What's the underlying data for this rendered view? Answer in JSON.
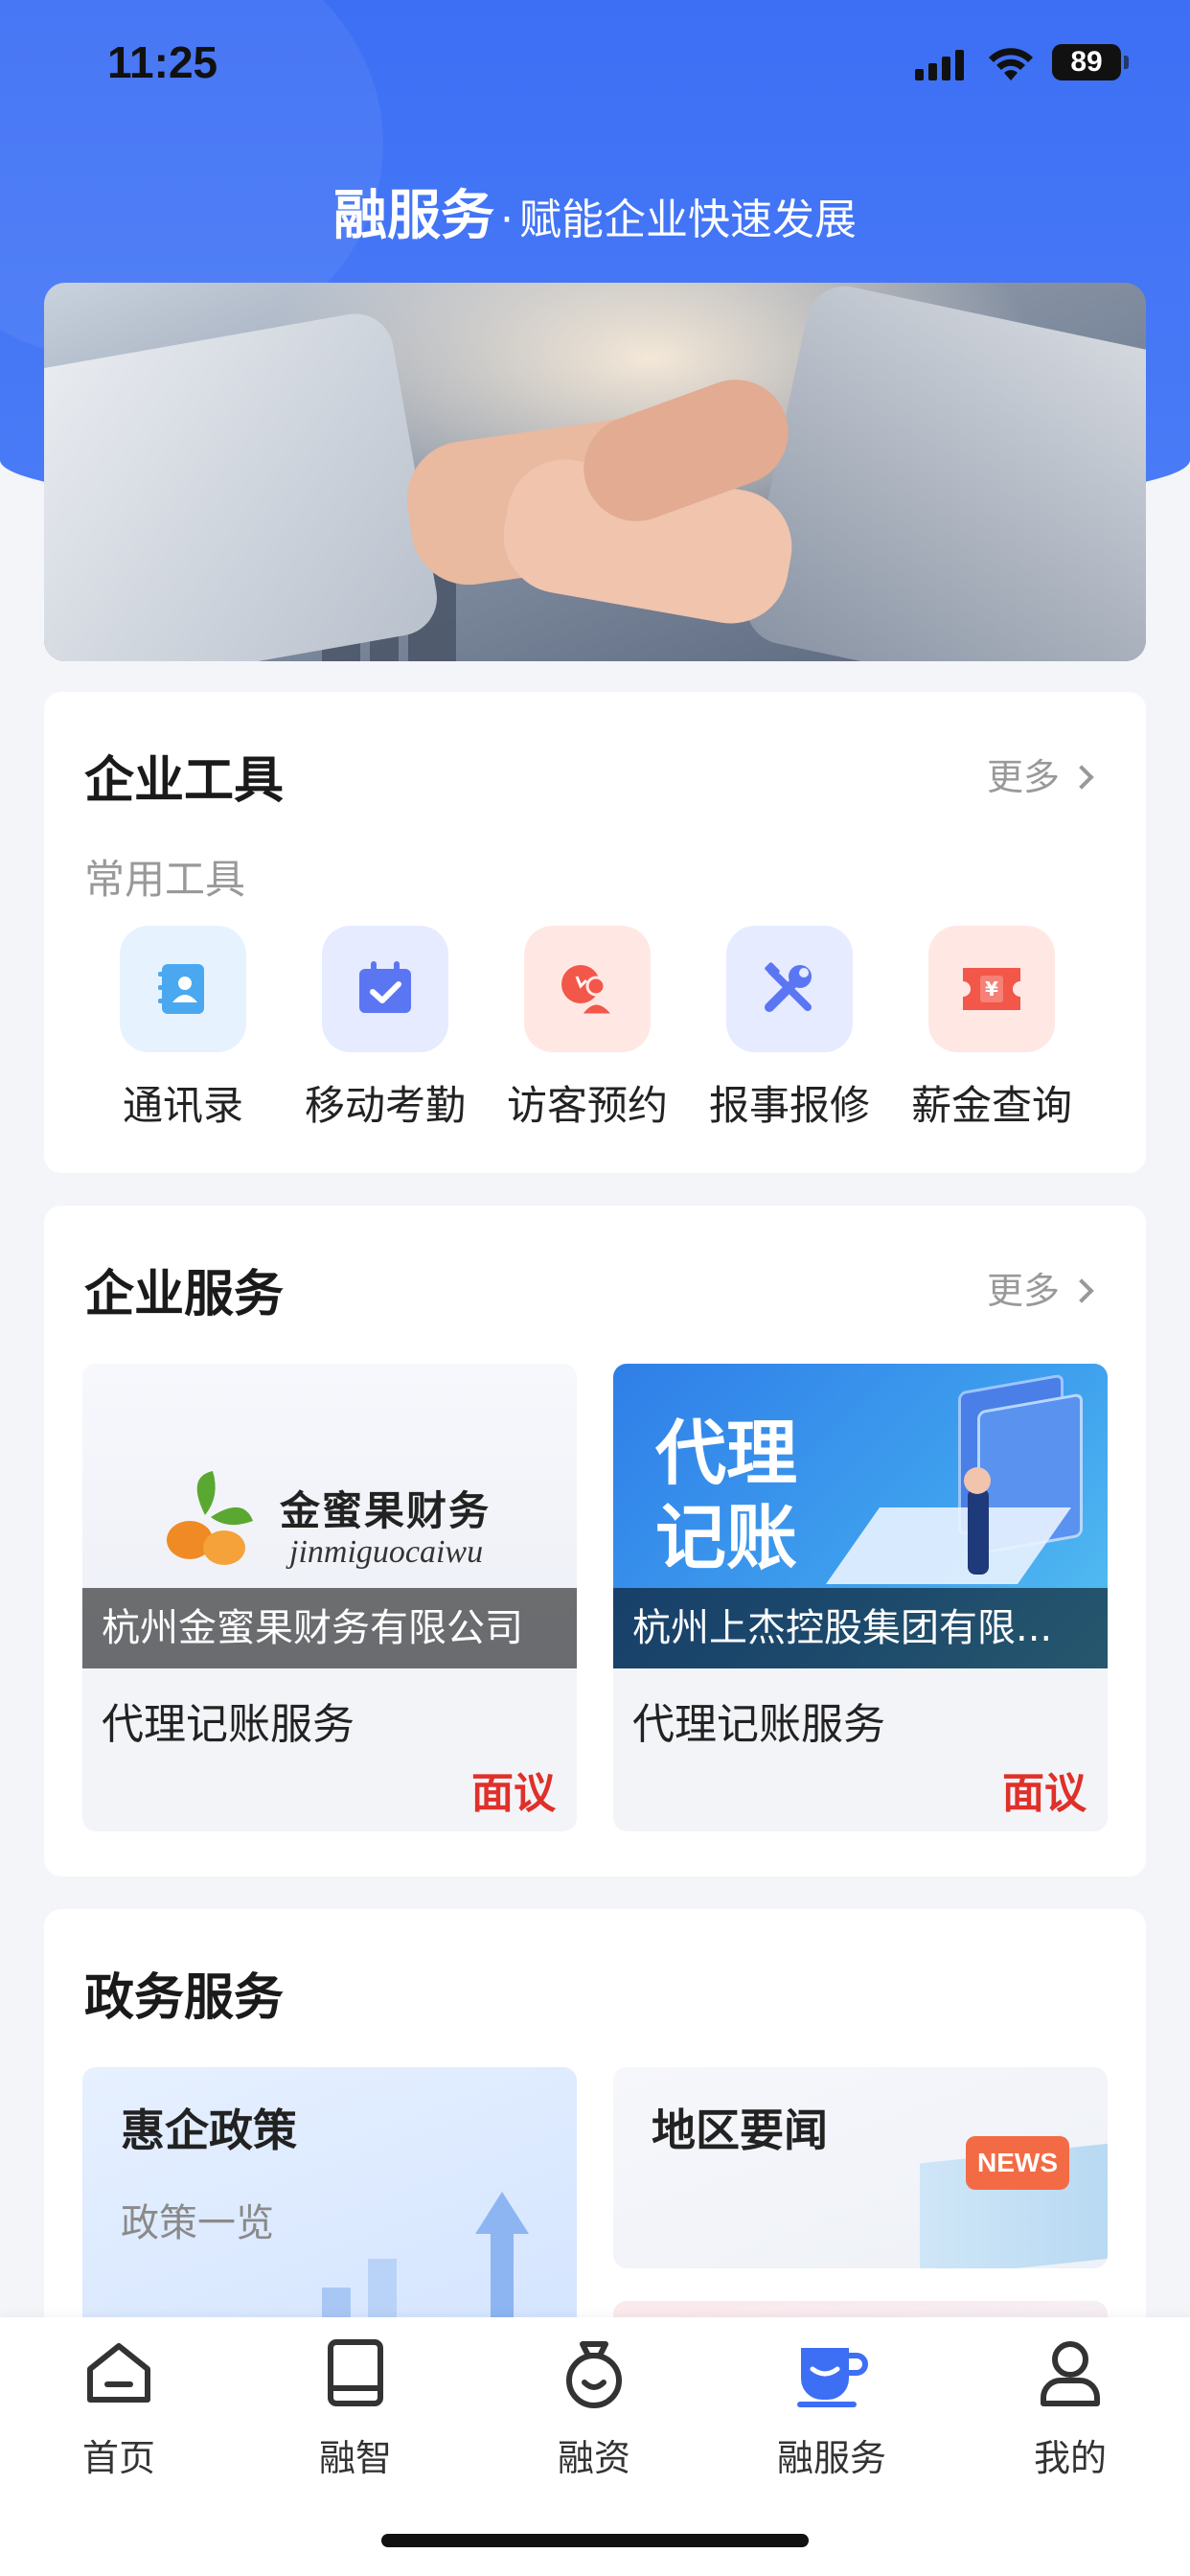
{
  "status_bar": {
    "time": "11:25",
    "battery": "89"
  },
  "header": {
    "title": "融服务",
    "separator": "·",
    "subtitle": "赋能企业快速发展"
  },
  "tools_section": {
    "title": "企业工具",
    "more_label": "更多",
    "subtitle": "常用工具",
    "items": [
      {
        "label": "通讯录",
        "icon": "contacts-icon",
        "bg": "#e6f3ff",
        "color": "#4aa8f0"
      },
      {
        "label": "移动考勤",
        "icon": "calendar-check-icon",
        "bg": "#e6ebff",
        "color": "#5b76f2"
      },
      {
        "label": "访客预约",
        "icon": "visitor-icon",
        "bg": "#ffe8e4",
        "color": "#f2574a"
      },
      {
        "label": "报事报修",
        "icon": "tools-icon",
        "bg": "#e6ebff",
        "color": "#5b76f2"
      },
      {
        "label": "薪金查询",
        "icon": "salary-ticket-icon",
        "bg": "#ffe8e4",
        "color": "#f2574a",
        "symbol": "¥"
      }
    ]
  },
  "services_section": {
    "title": "企业服务",
    "more_label": "更多",
    "items": [
      {
        "company": "杭州金蜜果财务有限公司",
        "service": "代理记账服务",
        "price": "面议",
        "logo_text": "金蜜果财务",
        "logo_pinyin": "jinmiguocaiwu"
      },
      {
        "company": "杭州上杰控股集团有限...",
        "service": "代理记账服务",
        "price": "面议",
        "image_text_line1": "代理",
        "image_text_line2": "记账"
      }
    ]
  },
  "gov_section": {
    "title": "政务服务",
    "items": [
      {
        "title": "惠企政策",
        "subtitle": "政策一览"
      },
      {
        "title": "地区要闻",
        "badge": "NEWS"
      }
    ]
  },
  "tabbar": {
    "items": [
      {
        "label": "首页",
        "icon": "home-icon",
        "active": false
      },
      {
        "label": "融智",
        "icon": "book-icon",
        "active": false
      },
      {
        "label": "融资",
        "icon": "money-bag-icon",
        "active": false
      },
      {
        "label": "融服务",
        "icon": "cup-icon",
        "active": true
      },
      {
        "label": "我的",
        "icon": "user-icon",
        "active": false
      }
    ]
  },
  "colors": {
    "primary": "#3d6ff5",
    "price_red": "#e0302a",
    "active_tab": "#3d6ff5"
  }
}
